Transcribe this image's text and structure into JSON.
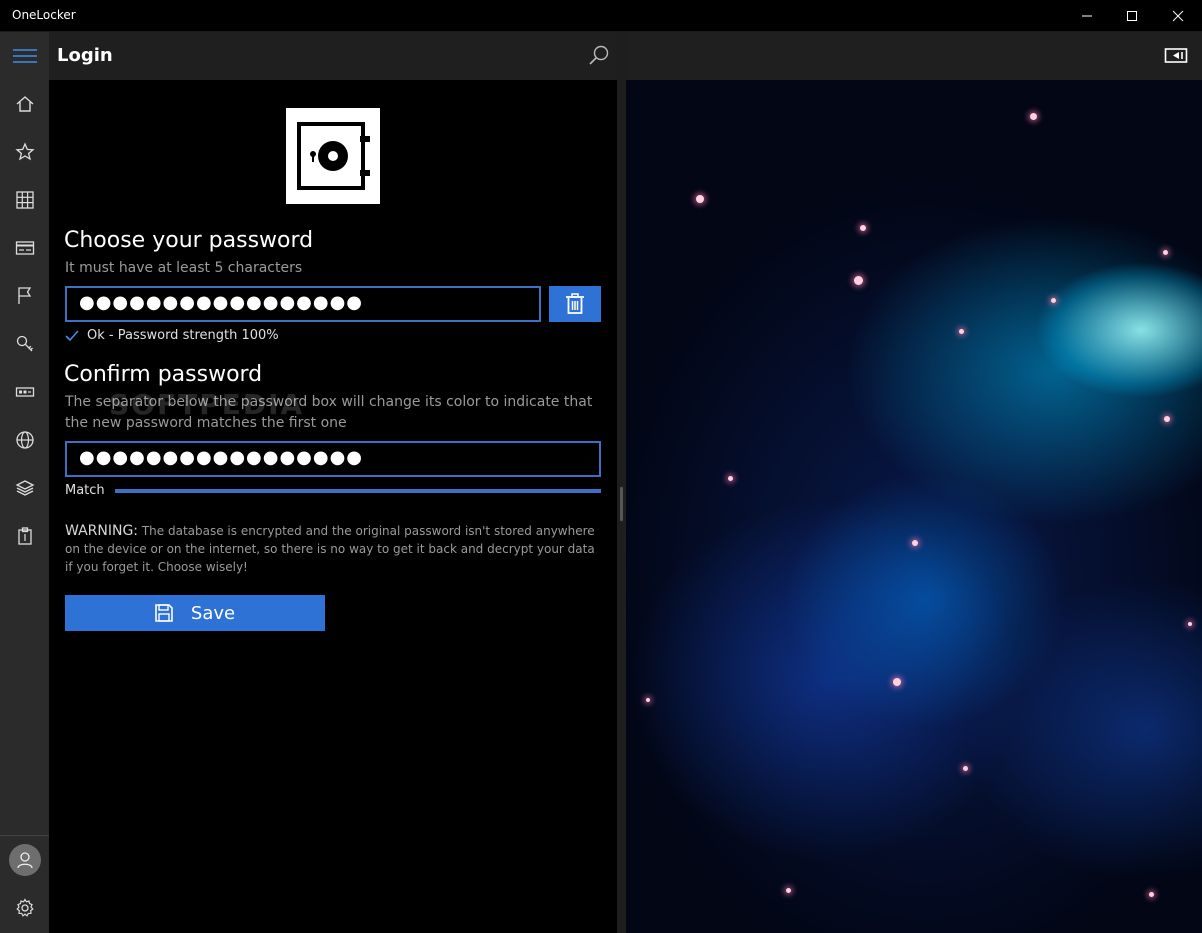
{
  "window": {
    "title": "OneLocker"
  },
  "nav": {
    "items": [
      "menu-icon",
      "home-icon",
      "star-icon",
      "grid-icon",
      "card-icon",
      "flag-icon",
      "key-icon",
      "ticket-icon",
      "globe-icon",
      "layers-icon",
      "clipboard-icon"
    ],
    "bottom": [
      "avatar-icon",
      "gear-icon"
    ]
  },
  "header": {
    "title": "Login"
  },
  "form": {
    "choose_title": "Choose your password",
    "choose_hint": "It must have at least 5 characters",
    "password_value": "●●●●●●●●●●●●●●●●●",
    "strength_text": "Ok - Password strength 100%",
    "confirm_title": "Confirm password",
    "confirm_hint": "The separator below the password box will change its color to indicate that the new password matches the first one",
    "confirm_value": "●●●●●●●●●●●●●●●●●",
    "match_label": "Match",
    "warning_title": "WARNING:",
    "warning_text": " The database is encrypted and the original password isn't stored anywhere on the device or on the internet, so there is no way to get it back and decrypt your data if you forget it. Choose wisely!",
    "save_label": "Save"
  },
  "watermark": "SOFTPEDIA",
  "colors": {
    "accent": "#2f72d6",
    "rail": "#2b2b2b",
    "header": "#1f1f1f"
  }
}
